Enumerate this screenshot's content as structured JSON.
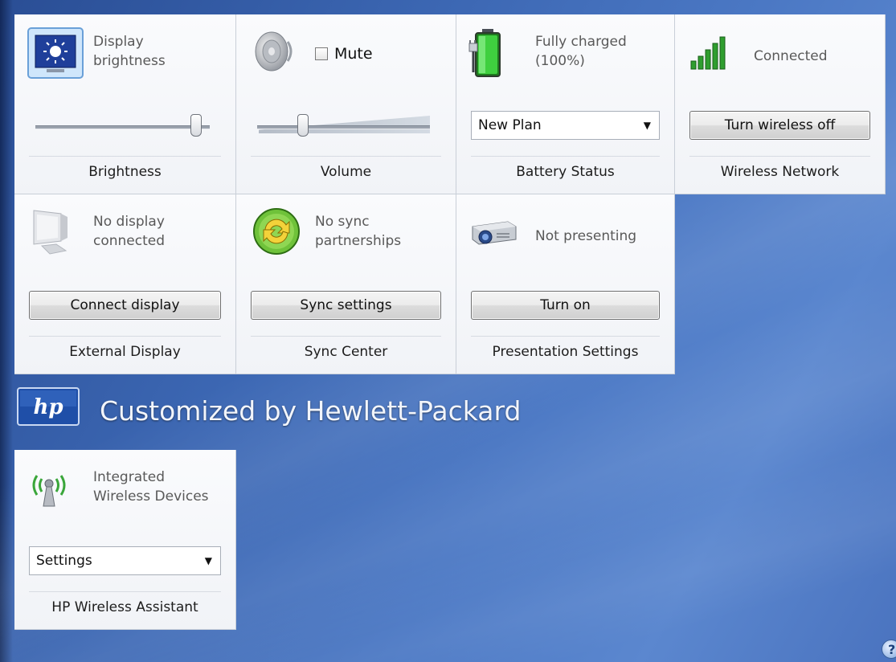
{
  "tiles": {
    "brightness": {
      "status": "Display\nbrightness",
      "title": "Brightness",
      "level": 0.95
    },
    "volume": {
      "mute_label": "Mute",
      "muted": false,
      "title": "Volume",
      "level": 0.25
    },
    "battery": {
      "status": "Fully charged\n(100%)",
      "plan": "New Plan",
      "title": "Battery Status"
    },
    "wireless": {
      "status": "Connected",
      "button": "Turn wireless off",
      "title": "Wireless Network"
    },
    "external_display": {
      "status": "No display\nconnected",
      "button": "Connect display",
      "title": "External Display"
    },
    "sync": {
      "status": "No sync\npartnerships",
      "button": "Sync settings",
      "title": "Sync Center"
    },
    "presentation": {
      "status": "Not presenting",
      "button": "Turn on",
      "title": "Presentation Settings"
    },
    "hp_wireless": {
      "status": "Integrated\nWireless Devices",
      "select": "Settings",
      "title": "HP Wireless Assistant"
    }
  },
  "brand": {
    "text": "Customized by Hewlett-Packard"
  },
  "help": {
    "glyph": "?"
  }
}
